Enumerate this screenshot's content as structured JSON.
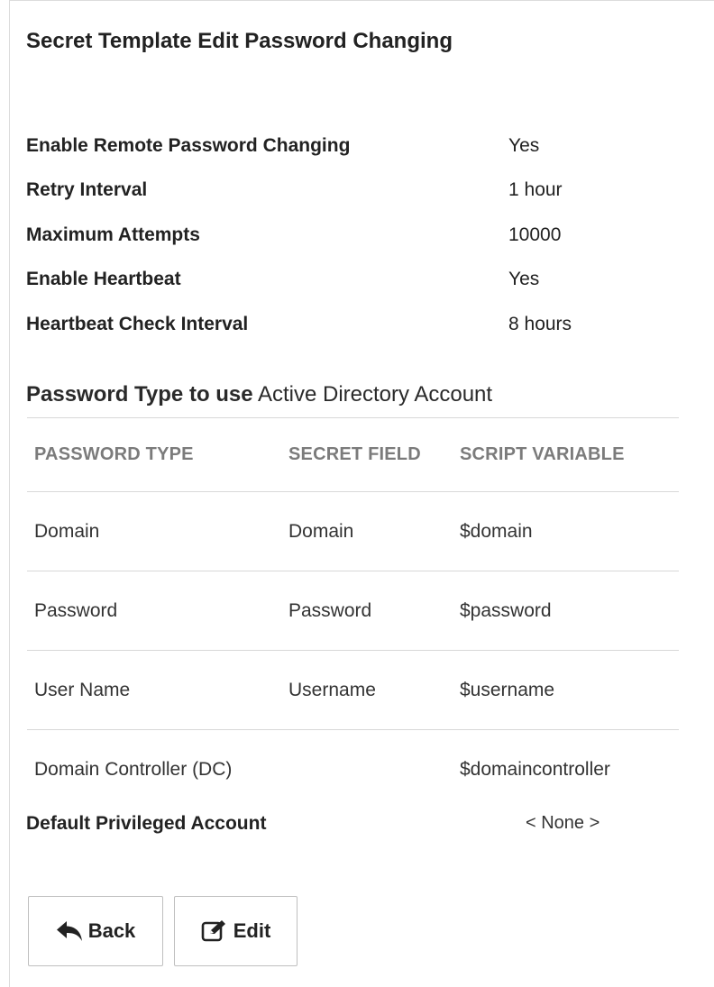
{
  "page": {
    "title": "Secret Template Edit Password Changing"
  },
  "settings": [
    {
      "label": "Enable Remote Password Changing",
      "value": "Yes"
    },
    {
      "label": "Retry Interval",
      "value": "1 hour"
    },
    {
      "label": "Maximum Attempts",
      "value": "10000"
    },
    {
      "label": "Enable Heartbeat",
      "value": "Yes"
    },
    {
      "label": "Heartbeat Check Interval",
      "value": "8 hours"
    }
  ],
  "password_type": {
    "label": "Password Type to use",
    "value": "Active Directory Account"
  },
  "table": {
    "headers": [
      "PASSWORD TYPE",
      "SECRET FIELD",
      "SCRIPT VARIABLE"
    ],
    "rows": [
      [
        "Domain",
        "Domain",
        "$domain"
      ],
      [
        "Password",
        "Password",
        "$password"
      ],
      [
        "User Name",
        "Username",
        "$username"
      ],
      [
        "Domain Controller (DC)",
        "",
        "$domaincontroller"
      ]
    ]
  },
  "privileged": {
    "label": "Default Privileged Account",
    "value": "< None >"
  },
  "buttons": {
    "back_label": "Back",
    "back_icon": "reply-arrow-icon",
    "edit_label": "Edit",
    "edit_icon": "edit-square-icon"
  }
}
